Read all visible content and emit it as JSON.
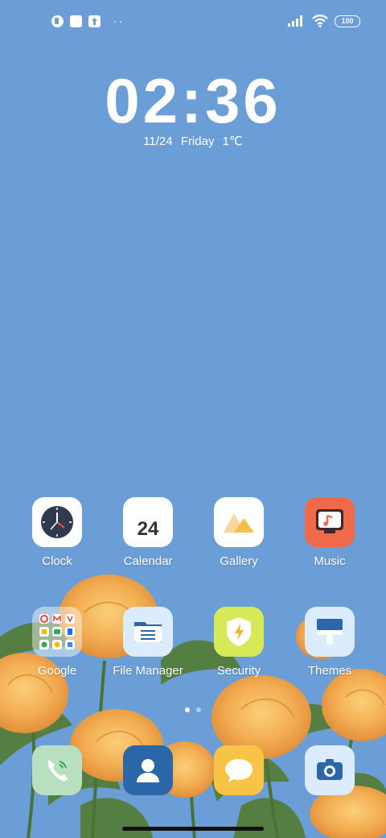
{
  "status_bar": {
    "notification_icons": [
      "app-notification-icon",
      "square-notification-icon",
      "upload-notification-icon",
      "more-dots-icon"
    ],
    "battery": "100"
  },
  "lockscreen": {
    "time": "02:36",
    "date": "11/24  Friday  1℃"
  },
  "apps": {
    "row1": [
      {
        "label": "Clock",
        "icon": "clock-icon"
      },
      {
        "label": "Calendar",
        "icon": "calendar-icon",
        "badge": "24"
      },
      {
        "label": "Gallery",
        "icon": "gallery-icon"
      },
      {
        "label": "Music",
        "icon": "music-icon"
      }
    ],
    "row2": [
      {
        "label": "Google",
        "icon": "folder-icon"
      },
      {
        "label": "File Manager",
        "icon": "file-manager-icon"
      },
      {
        "label": "Security",
        "icon": "security-icon"
      },
      {
        "label": "Themes",
        "icon": "themes-icon"
      }
    ]
  },
  "dock": [
    {
      "icon": "phone-icon"
    },
    {
      "icon": "contacts-icon"
    },
    {
      "icon": "messages-icon"
    },
    {
      "icon": "camera-icon"
    }
  ],
  "pages": {
    "count": 2,
    "active": 0
  },
  "colors": {
    "sky": "#6b9ed6",
    "rose": "#f2a84b",
    "leaf": "#4f7a3a"
  }
}
